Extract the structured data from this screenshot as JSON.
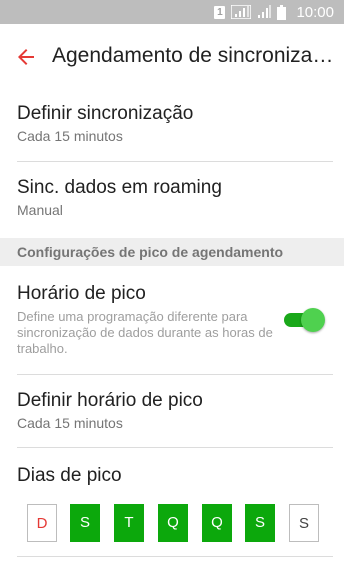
{
  "status_bar": {
    "sim_label": "1",
    "time": "10:00",
    "icons": [
      "sim-icon",
      "signal-icon",
      "signal-icon",
      "battery-icon"
    ]
  },
  "toolbar": {
    "back_icon": "arrow-left-icon",
    "title": "Agendamento de sincronização"
  },
  "colors": {
    "accent": "#e53935",
    "toggle_on": "#1aa81a",
    "day_on": "#0ca80c",
    "day_sunday_text": "#e53935",
    "section_bg": "#eeeeee"
  },
  "settings": {
    "sync": {
      "title": "Definir sincronização",
      "summary": "Cada 15 minutos"
    },
    "roaming": {
      "title": "Sinc. dados em roaming",
      "summary": "Manual"
    },
    "section_header": "Configurações de pico de agendamento",
    "peak": {
      "title": "Horário de pico",
      "summary": "Define uma programação diferente para sincronização de dados durante as horas de trabalho.",
      "enabled": true
    },
    "peak_time": {
      "title": "Definir horário de pico",
      "summary": "Cada 15 minutos"
    },
    "peak_days": {
      "title": "Dias de pico",
      "days": [
        {
          "label": "D",
          "selected": false
        },
        {
          "label": "S",
          "selected": true
        },
        {
          "label": "T",
          "selected": true
        },
        {
          "label": "Q",
          "selected": true
        },
        {
          "label": "Q",
          "selected": true
        },
        {
          "label": "S",
          "selected": true
        },
        {
          "label": "S",
          "selected": false
        }
      ]
    }
  }
}
